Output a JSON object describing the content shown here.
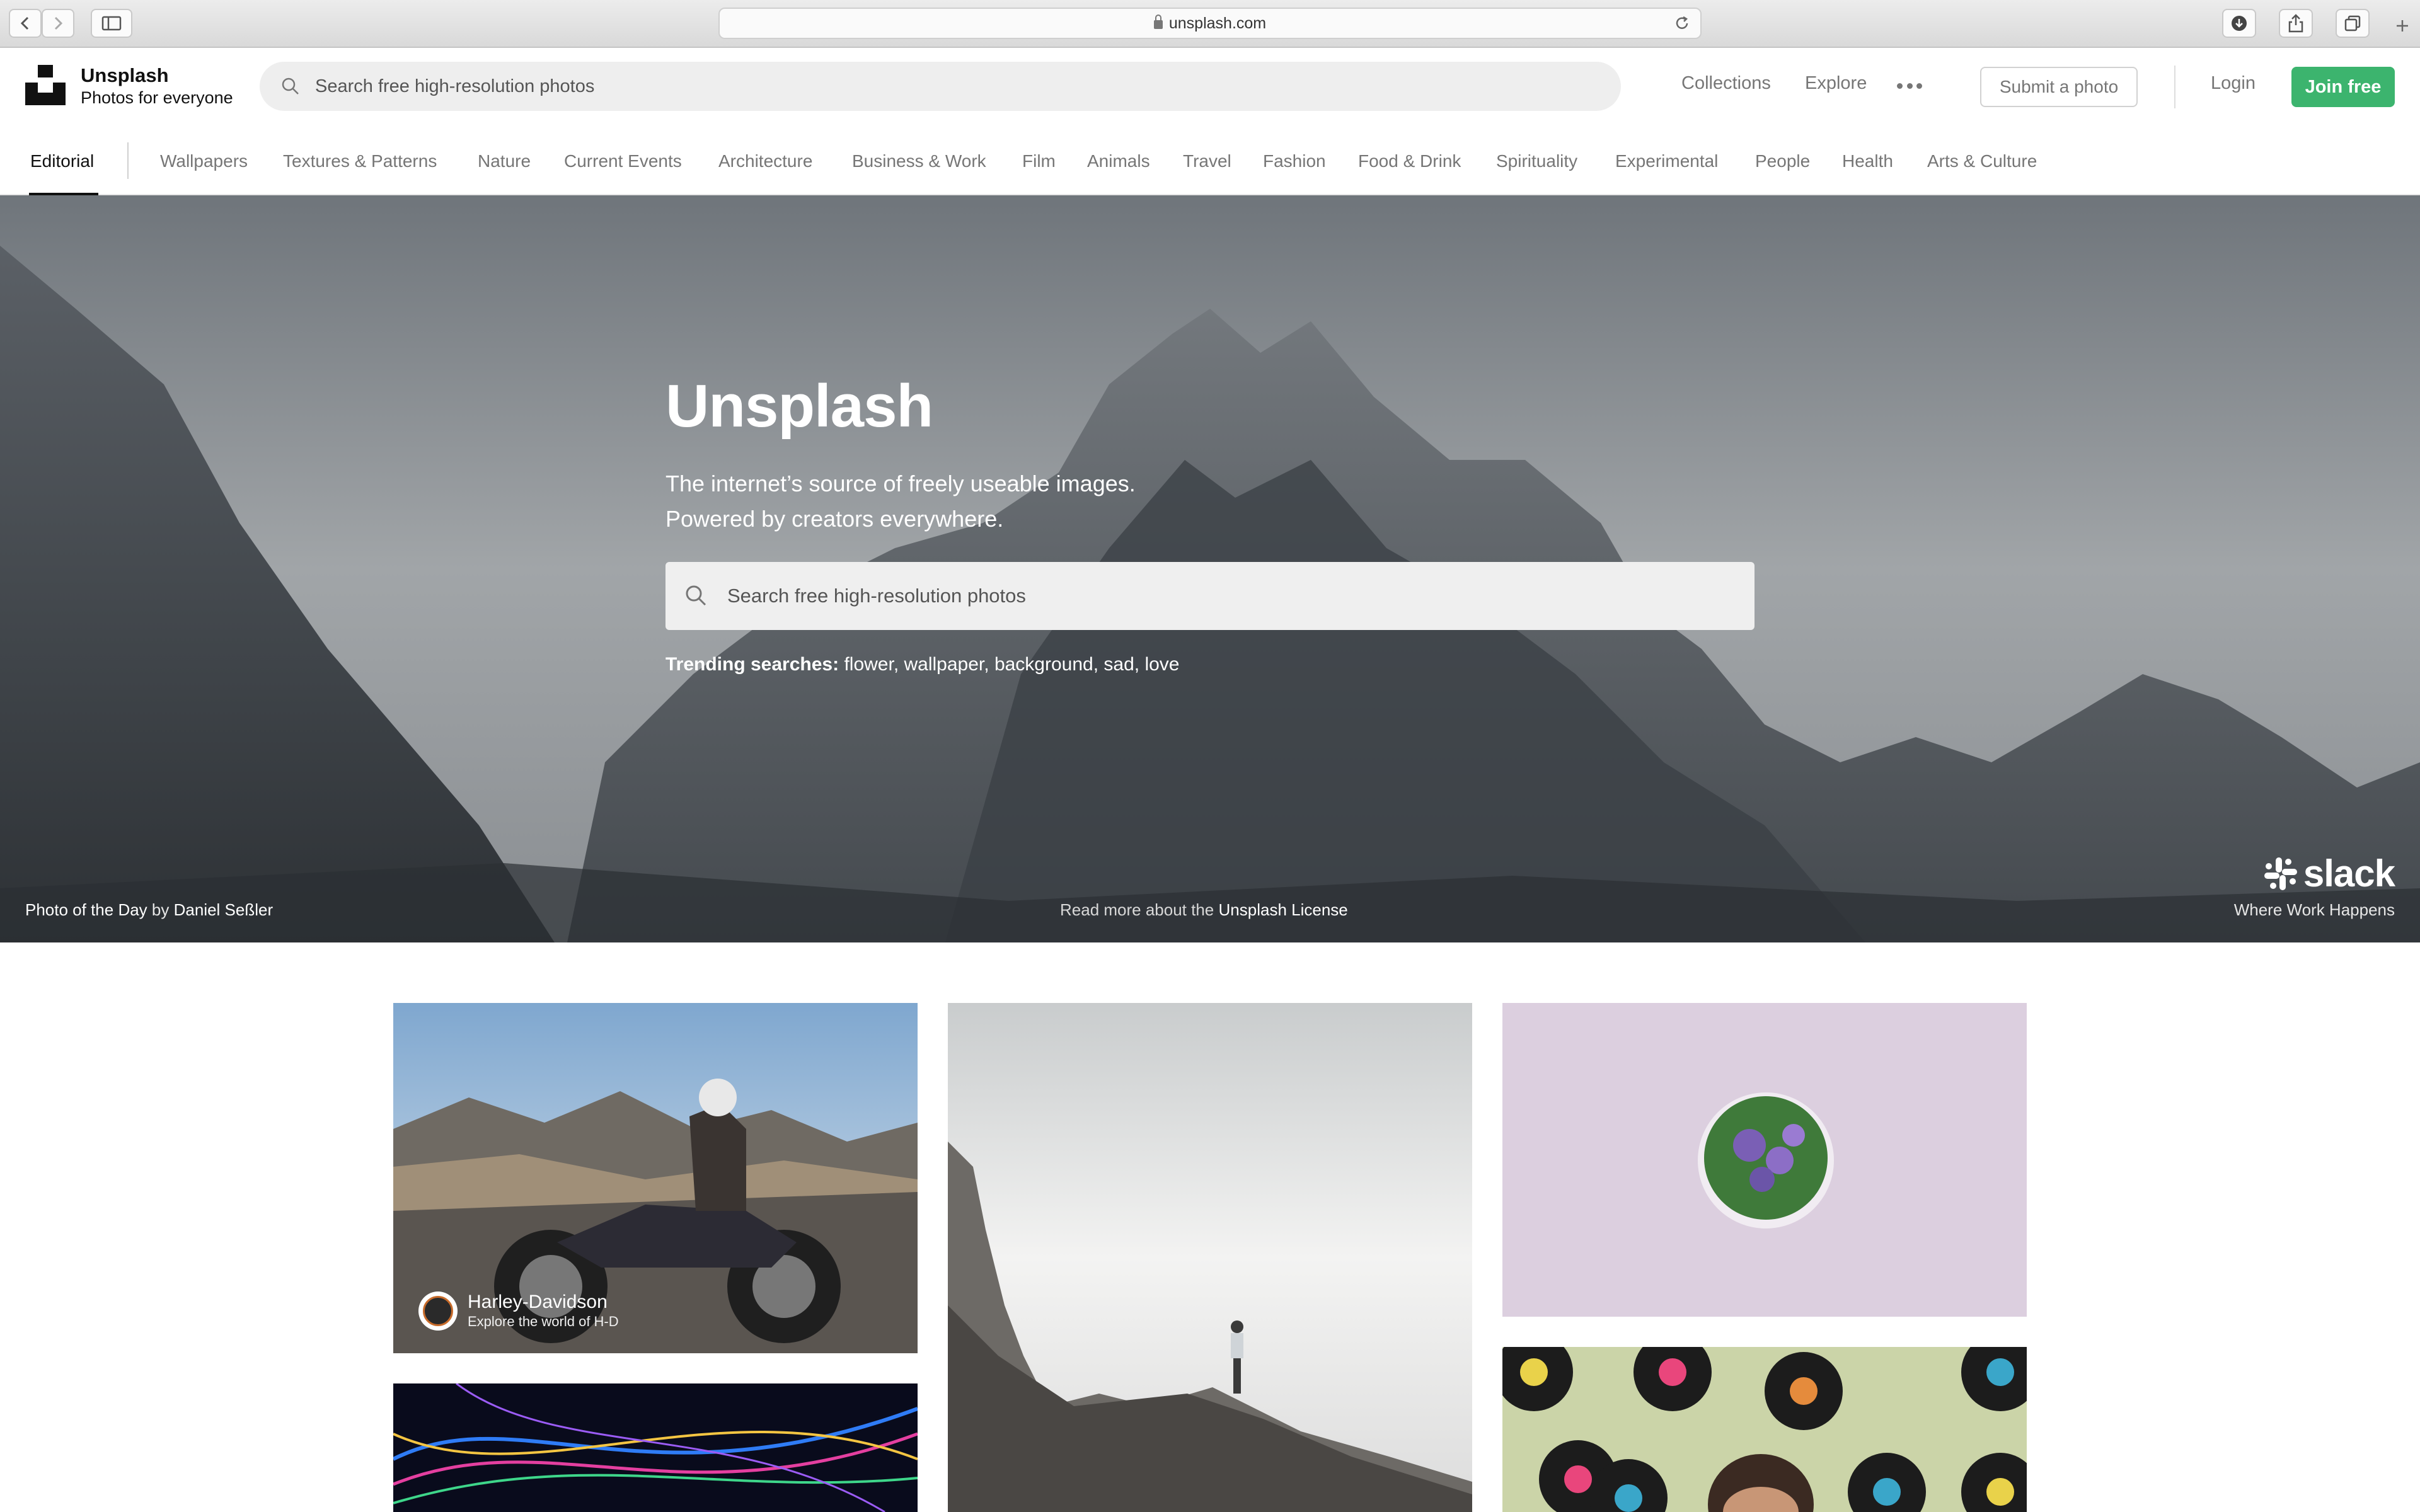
{
  "browser": {
    "url": "unsplash.com",
    "nav_icons": [
      "back-icon",
      "forward-icon",
      "sidebar-icon"
    ],
    "toolbar_icons": [
      "download-icon",
      "share-icon",
      "tabs-icon",
      "new-tab-icon"
    ]
  },
  "header": {
    "brand_title": "Unsplash",
    "brand_subtitle": "Photos for everyone",
    "search_placeholder": "Search free high-resolution photos",
    "links": {
      "collections": "Collections",
      "explore": "Explore"
    },
    "submit_label": "Submit a photo",
    "login_label": "Login",
    "join_label": "Join free",
    "join_color": "#3cb46e"
  },
  "categories": {
    "active": "Editorial",
    "items": [
      "Wallpapers",
      "Textures & Patterns",
      "Nature",
      "Current Events",
      "Architecture",
      "Business & Work",
      "Film",
      "Animals",
      "Travel",
      "Fashion",
      "Food & Drink",
      "Spirituality",
      "Experimental",
      "People",
      "Health",
      "Arts & Culture"
    ]
  },
  "hero": {
    "title": "Unsplash",
    "tagline_1": "The internet’s source of freely useable images.",
    "tagline_2": "Powered by creators everywhere.",
    "search_placeholder": "Search free high-resolution photos",
    "trending_label": "Trending searches:",
    "trending": [
      "flower",
      "wallpaper",
      "background",
      "sad",
      "love"
    ],
    "credit_prefix": "Photo of the Day",
    "credit_by": "by",
    "credit_author": "Daniel Seßler",
    "license_prefix": "Read more about the",
    "license_link": "Unsplash License",
    "sponsor_name": "slack",
    "sponsor_tagline": "Where Work Happens"
  },
  "grid": {
    "featured": {
      "author": "Harley-Davidson",
      "subtitle": "Explore the world of H-D"
    }
  }
}
